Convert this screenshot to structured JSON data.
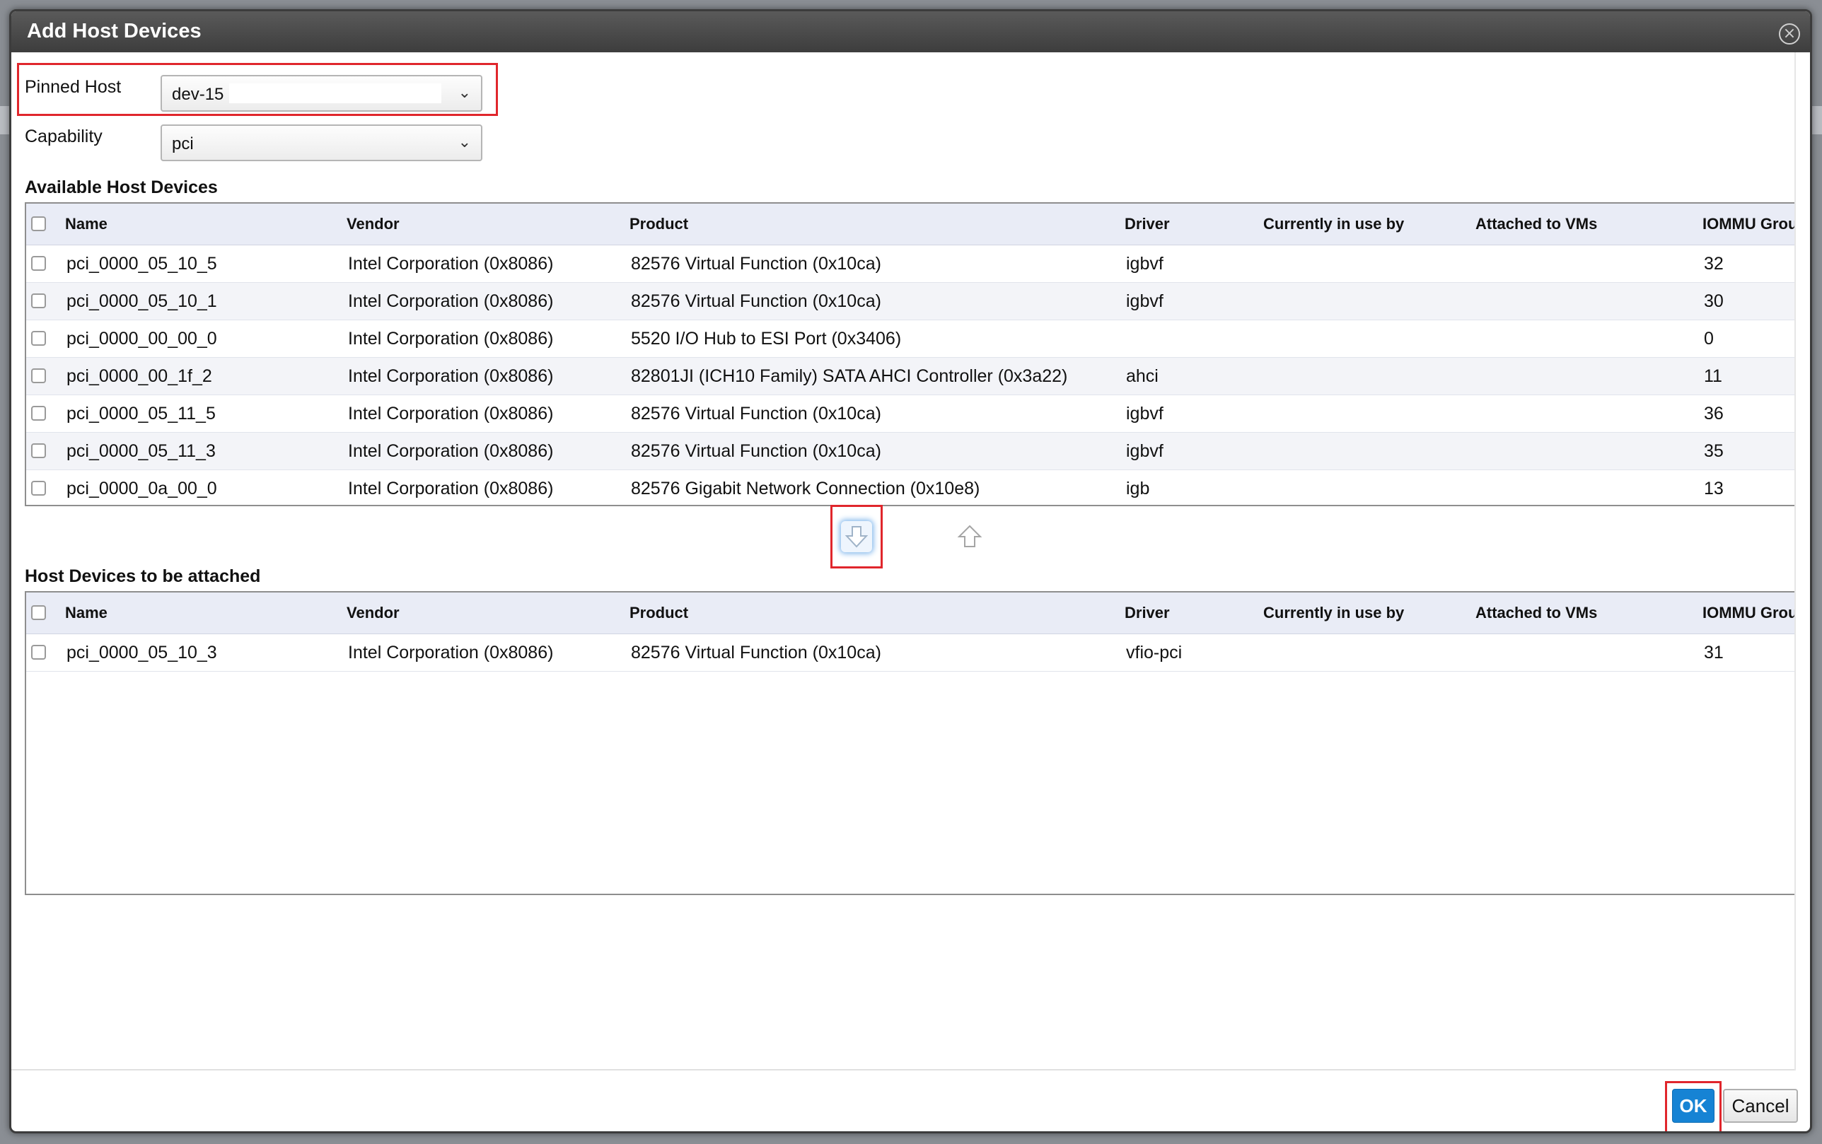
{
  "dialog": {
    "title": "Add Host Devices"
  },
  "form": {
    "pinned_host_label": "Pinned Host",
    "pinned_host_value": "dev-15",
    "capability_label": "Capability",
    "capability_value": "pci"
  },
  "columns": [
    "Name",
    "Vendor",
    "Product",
    "Driver",
    "Currently in use by",
    "Attached to VMs",
    "IOMMU Group"
  ],
  "available": {
    "title": "Available Host Devices",
    "rows": [
      {
        "name": "pci_0000_05_10_5",
        "vendor": "Intel Corporation (0x8086)",
        "product": "82576 Virtual Function (0x10ca)",
        "driver": "igbvf",
        "in_use_by": "",
        "attached_vms": "",
        "iommu": "32"
      },
      {
        "name": "pci_0000_05_10_1",
        "vendor": "Intel Corporation (0x8086)",
        "product": "82576 Virtual Function (0x10ca)",
        "driver": "igbvf",
        "in_use_by": "",
        "attached_vms": "",
        "iommu": "30"
      },
      {
        "name": "pci_0000_00_00_0",
        "vendor": "Intel Corporation (0x8086)",
        "product": "5520 I/O Hub to ESI Port (0x3406)",
        "driver": "",
        "in_use_by": "",
        "attached_vms": "",
        "iommu": "0"
      },
      {
        "name": "pci_0000_00_1f_2",
        "vendor": "Intel Corporation (0x8086)",
        "product": "82801JI (ICH10 Family) SATA AHCI Controller (0x3a22)",
        "driver": "ahci",
        "in_use_by": "",
        "attached_vms": "",
        "iommu": "11"
      },
      {
        "name": "pci_0000_05_11_5",
        "vendor": "Intel Corporation (0x8086)",
        "product": "82576 Virtual Function (0x10ca)",
        "driver": "igbvf",
        "in_use_by": "",
        "attached_vms": "",
        "iommu": "36"
      },
      {
        "name": "pci_0000_05_11_3",
        "vendor": "Intel Corporation (0x8086)",
        "product": "82576 Virtual Function (0x10ca)",
        "driver": "igbvf",
        "in_use_by": "",
        "attached_vms": "",
        "iommu": "35"
      },
      {
        "name": "pci_0000_0a_00_0",
        "vendor": "Intel Corporation (0x8086)",
        "product": "82576 Gigabit Network Connection (0x10e8)",
        "driver": "igb",
        "in_use_by": "",
        "attached_vms": "",
        "iommu": "13"
      }
    ]
  },
  "attached": {
    "title": "Host Devices to be attached",
    "rows": [
      {
        "name": "pci_0000_05_10_3",
        "vendor": "Intel Corporation (0x8086)",
        "product": "82576 Virtual Function (0x10ca)",
        "driver": "vfio-pci",
        "in_use_by": "",
        "attached_vms": "",
        "iommu": "31"
      }
    ]
  },
  "icons": {
    "close": "close-icon",
    "move_down": "arrow-down-icon",
    "move_up": "arrow-up-icon",
    "dropdown": "chevron-down-icon"
  },
  "buttons": {
    "ok": "OK",
    "cancel": "Cancel"
  },
  "colors": {
    "accent": "#1683d4",
    "highlight": "#e0262c",
    "header_bg": "#e9ecf6",
    "titlebar": "#3d3d3d"
  }
}
